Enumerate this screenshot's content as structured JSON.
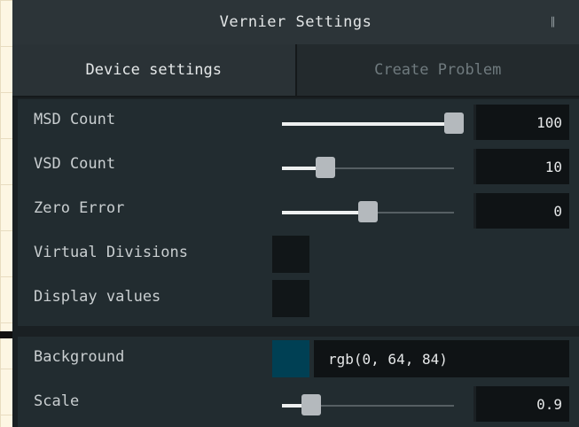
{
  "window": {
    "title": "Vernier Settings",
    "pin_glyph": "∥"
  },
  "tabs": [
    {
      "label": "Device settings",
      "active": true
    },
    {
      "label": "Create Problem",
      "active": false
    }
  ],
  "settings": {
    "msd_count": {
      "label": "MSD Count",
      "value": "100",
      "slider_fraction": 1.0
    },
    "vsd_count": {
      "label": "VSD Count",
      "value": "10",
      "slider_fraction": 0.25
    },
    "zero_error": {
      "label": "Zero Error",
      "value": "0",
      "slider_fraction": 0.5
    },
    "virtual_divisions": {
      "label": "Virtual Divisions",
      "checked": false
    },
    "display_values": {
      "label": "Display values",
      "checked": false
    }
  },
  "appearance": {
    "background": {
      "label": "Background",
      "value": "rgb(0, 64, 84)",
      "color": "#004054"
    },
    "scale": {
      "label": "Scale",
      "value": "0.9",
      "slider_fraction": 0.17
    }
  }
}
